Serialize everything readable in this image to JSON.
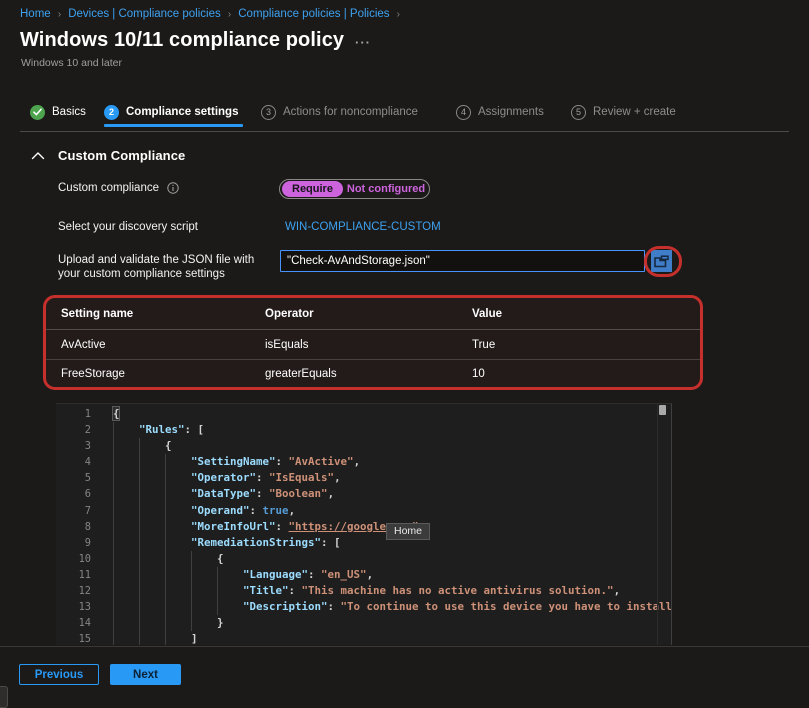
{
  "colors": {
    "accent_blue": "#2899f5",
    "link_blue": "#3ea1ef",
    "success_green": "#4ea44e",
    "toggle_purple": "#cd64dd",
    "annotation_red": "#c5302c",
    "editor_key": "#9cdcfe",
    "editor_string": "#ce9178",
    "editor_keyword": "#569cd6"
  },
  "breadcrumb": {
    "separator": "›",
    "items": [
      "Home",
      "Devices | Compliance policies",
      "Compliance policies | Policies"
    ]
  },
  "header": {
    "title": "Windows 10/11 compliance policy",
    "more_menu": "···",
    "subtitle": "Windows 10 and later"
  },
  "wizard": {
    "steps": [
      {
        "label": "Basics",
        "status": "complete"
      },
      {
        "number": "2",
        "label": "Compliance settings",
        "status": "current"
      },
      {
        "number": "3",
        "label": "Actions for noncompliance",
        "status": "upcoming"
      },
      {
        "number": "4",
        "label": "Assignments",
        "status": "upcoming"
      },
      {
        "number": "5",
        "label": "Review + create",
        "status": "upcoming"
      }
    ]
  },
  "section": {
    "title": "Custom Compliance"
  },
  "form": {
    "custom_compliance": {
      "label": "Custom compliance",
      "options": [
        "Require",
        "Not configured"
      ],
      "selected": "Require"
    },
    "discovery_script": {
      "label": "Select your discovery script",
      "value": "WIN-COMPLIANCE-CUSTOM"
    },
    "upload": {
      "label_line1": "Upload and validate the JSON file with",
      "label_line2": "your custom compliance settings",
      "value": "\"Check-AvAndStorage.json\""
    }
  },
  "table": {
    "columns": [
      "Setting name",
      "Operator",
      "Value"
    ],
    "rows": [
      [
        "AvActive",
        "isEquals",
        "True"
      ],
      [
        "FreeStorage",
        "greaterEquals",
        "10"
      ]
    ]
  },
  "editor": {
    "tooltip": "Home",
    "lines": [
      {
        "n": "1",
        "t": [
          [
            "p",
            "{"
          ]
        ]
      },
      {
        "n": "2",
        "t": [
          [
            "p",
            "    "
          ],
          [
            "k",
            "\"Rules\""
          ],
          [
            "p",
            ": ["
          ]
        ]
      },
      {
        "n": "3",
        "t": [
          [
            "p",
            "        {"
          ]
        ]
      },
      {
        "n": "4",
        "t": [
          [
            "p",
            "            "
          ],
          [
            "k",
            "\"SettingName\""
          ],
          [
            "p",
            ": "
          ],
          [
            "s",
            "\"AvActive\""
          ],
          [
            "p",
            ","
          ]
        ]
      },
      {
        "n": "5",
        "t": [
          [
            "p",
            "            "
          ],
          [
            "k",
            "\"Operator\""
          ],
          [
            "p",
            ": "
          ],
          [
            "s",
            "\"IsEquals\""
          ],
          [
            "p",
            ","
          ]
        ]
      },
      {
        "n": "6",
        "t": [
          [
            "p",
            "            "
          ],
          [
            "k",
            "\"DataType\""
          ],
          [
            "p",
            ": "
          ],
          [
            "s",
            "\"Boolean\""
          ],
          [
            "p",
            ","
          ]
        ]
      },
      {
        "n": "7",
        "t": [
          [
            "p",
            "            "
          ],
          [
            "k",
            "\"Operand\""
          ],
          [
            "p",
            ": "
          ],
          [
            "b",
            "true"
          ],
          [
            "p",
            ","
          ]
        ]
      },
      {
        "n": "8",
        "t": [
          [
            "p",
            "            "
          ],
          [
            "k",
            "\"MoreInfoUrl\""
          ],
          [
            "p",
            ": "
          ],
          [
            "u",
            "\"https://google.com\""
          ],
          [
            "p",
            ","
          ]
        ]
      },
      {
        "n": "9",
        "t": [
          [
            "p",
            "            "
          ],
          [
            "k",
            "\"RemediationStrings\""
          ],
          [
            "p",
            ": ["
          ]
        ]
      },
      {
        "n": "10",
        "t": [
          [
            "p",
            "                {"
          ]
        ]
      },
      {
        "n": "11",
        "t": [
          [
            "p",
            "                    "
          ],
          [
            "k",
            "\"Language\""
          ],
          [
            "p",
            ": "
          ],
          [
            "s",
            "\"en_US\""
          ],
          [
            "p",
            ","
          ]
        ]
      },
      {
        "n": "12",
        "t": [
          [
            "p",
            "                    "
          ],
          [
            "k",
            "\"Title\""
          ],
          [
            "p",
            ": "
          ],
          [
            "s",
            "\"This machine has no active antivirus solution.\""
          ],
          [
            "p",
            ","
          ]
        ]
      },
      {
        "n": "13",
        "t": [
          [
            "p",
            "                    "
          ],
          [
            "k",
            "\"Description\""
          ],
          [
            "p",
            ": "
          ],
          [
            "s",
            "\"To continue to use this device you have to install a"
          ]
        ]
      },
      {
        "n": "14",
        "t": [
          [
            "p",
            "                }"
          ]
        ]
      },
      {
        "n": "15",
        "t": [
          [
            "p",
            "            ]"
          ]
        ]
      }
    ]
  },
  "footer": {
    "previous_label": "Previous",
    "next_label": "Next"
  }
}
